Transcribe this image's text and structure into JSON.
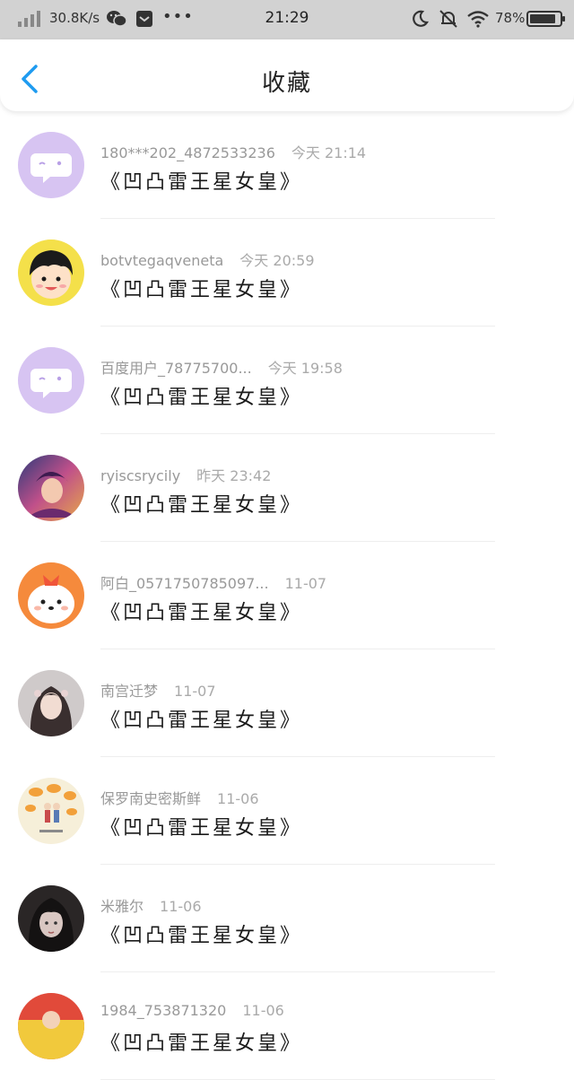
{
  "status_bar": {
    "net_speed": "30.8K/s",
    "dots": "•••",
    "time": "21:29",
    "battery": "78%"
  },
  "header": {
    "title": "收藏"
  },
  "items": [
    {
      "user": "180***202_4872533236",
      "time": "今天 21:14",
      "title": "《凹凸雷王星女皇》",
      "avatar": "chat-bubble-avatar"
    },
    {
      "user": "botvtegaqveneta",
      "time": "今天 20:59",
      "title": "《凹凸雷王星女皇》",
      "avatar": "cartoon-girl-avatar"
    },
    {
      "user": "百度用户_78775700...",
      "time": "今天 19:58",
      "title": "《凹凸雷王星女皇》",
      "avatar": "chat-bubble-avatar"
    },
    {
      "user": "ryiscsrycily",
      "time": "昨天 23:42",
      "title": "《凹凸雷王星女皇》",
      "avatar": "anime-art-avatar"
    },
    {
      "user": "阿白_0571750785097...",
      "time": "11-07",
      "title": "《凹凸雷王星女皇》",
      "avatar": "cute-puppy-avatar"
    },
    {
      "user": "南宫迁梦",
      "time": "11-07",
      "title": "《凹凸雷王星女皇》",
      "avatar": "girl-portrait-avatar"
    },
    {
      "user": "保罗南史密斯鲜",
      "time": "11-06",
      "title": "《凹凸雷王星女皇》",
      "avatar": "orange-fruit-avatar"
    },
    {
      "user": "米雅尔",
      "time": "11-06",
      "title": "《凹凸雷王星女皇》",
      "avatar": "dark-hair-girl-avatar"
    },
    {
      "user": "1984_753871320",
      "time": "11-06",
      "title": "《凹凸雷王星女皇》",
      "avatar": "red-yellow-avatar"
    }
  ],
  "colors": {
    "accent": "#1e9bf0",
    "status_bar_bg": "#d2d2d2",
    "default_avatar": "#d7c4f2"
  }
}
